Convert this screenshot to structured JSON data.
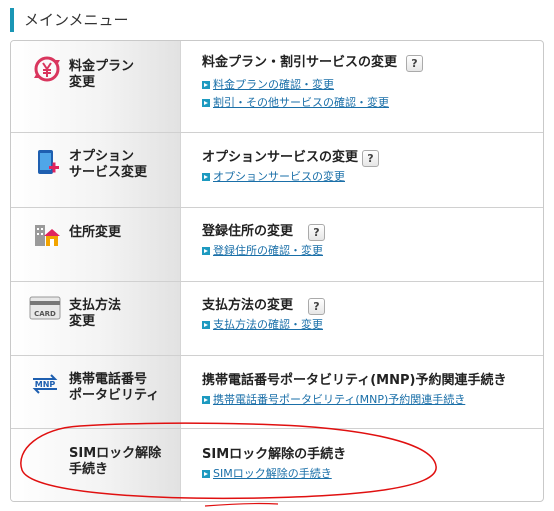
{
  "header": {
    "title": "メインメニュー"
  },
  "help_badge": "?",
  "rows": [
    {
      "category_line1": "料金プラン",
      "category_line2": "変更",
      "icon": "yen-swap-icon",
      "title": "料金プラン・割引サービスの変更",
      "has_help": true,
      "links": [
        "料金プランの確認・変更",
        "割引・その他サービスの確認・変更"
      ]
    },
    {
      "category_line1": "オプション",
      "category_line2": "サービス変更",
      "icon": "phone-plus-icon",
      "title": "オプションサービスの変更",
      "has_help": true,
      "links": [
        "オプションサービスの変更"
      ]
    },
    {
      "category_line1": "住所変更",
      "category_line2": "",
      "icon": "building-house-icon",
      "title": "登録住所の変更",
      "has_help": true,
      "links": [
        "登録住所の確認・変更"
      ]
    },
    {
      "category_line1": "支払方法",
      "category_line2": "変更",
      "icon": "card-icon",
      "icon_text": "CARD",
      "title": "支払方法の変更",
      "has_help": true,
      "links": [
        "支払方法の確認・変更"
      ]
    },
    {
      "category_line1": "携帯電話番号",
      "category_line2": "ポータビリティ",
      "icon": "mnp-icon",
      "icon_text": "MNP",
      "title": "携帯電話番号ポータビリティ(MNP)予約関連手続き",
      "has_help": false,
      "links": [
        "携帯電話番号ポータビリティ(MNP)予約関連手続き"
      ]
    },
    {
      "category_line1": "SIMロック解除",
      "category_line2": "手続き",
      "icon": "",
      "title": "SIMロック解除の手続き",
      "has_help": false,
      "links": [
        "SIMロック解除の手続き"
      ]
    }
  ],
  "colors": {
    "accent": "#1a96b5",
    "link": "#1a6fa8",
    "annotation": "#e01010"
  }
}
